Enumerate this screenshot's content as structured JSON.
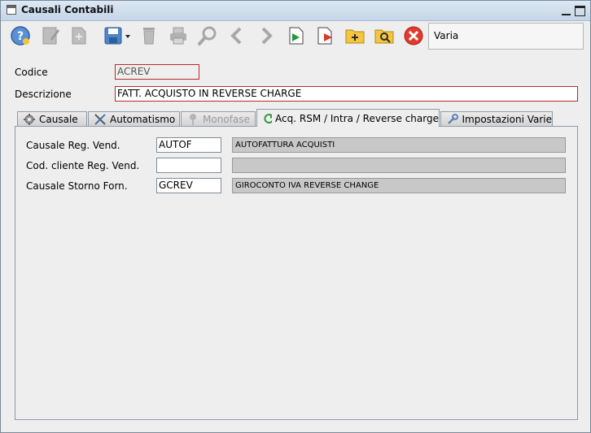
{
  "window": {
    "title": "Causali Contabili"
  },
  "toolbar": {
    "varia": "Varia",
    "icons": [
      "help-icon",
      "edit-icon",
      "new-document-icon",
      "save-icon",
      "delete-icon",
      "print-icon",
      "search-icon",
      "previous-icon",
      "next-icon",
      "export-green-icon",
      "export-red-icon",
      "add-folder-icon",
      "search-folder-icon",
      "close-red-icon"
    ]
  },
  "form": {
    "codice_label": "Codice",
    "codice_value": "ACREV",
    "descrizione_label": "Descrizione",
    "descrizione_value": "FATT. ACQUISTO IN REVERSE CHARGE"
  },
  "tabs": [
    {
      "label": "Causale",
      "icon": "gear-icon",
      "state": "normal"
    },
    {
      "label": "Automatismo",
      "icon": "tools-icon",
      "state": "normal"
    },
    {
      "label": "Monofase",
      "icon": "pin-icon",
      "state": "disabled"
    },
    {
      "label": "Acq. RSM / Intra / Reverse charge",
      "icon": "refresh-icon",
      "state": "active"
    },
    {
      "label": "Impostazioni Varie",
      "icon": "wrench-icon",
      "state": "normal"
    }
  ],
  "panel": {
    "rows": [
      {
        "label": "Causale Reg. Vend.",
        "code": "AUTOF",
        "desc": "AUTOFATTURA ACQUISTI"
      },
      {
        "label": "Cod. cliente Reg. Vend.",
        "code": "",
        "desc": ""
      },
      {
        "label": "Causale Storno Forn.",
        "code": "GCREV",
        "desc": "GIROCONTO IVA REVERSE CHANGE"
      }
    ]
  },
  "colors": {
    "required_border": "#b82a2a",
    "titlebar": "#c4d6e8",
    "background": "#eeeeee"
  }
}
